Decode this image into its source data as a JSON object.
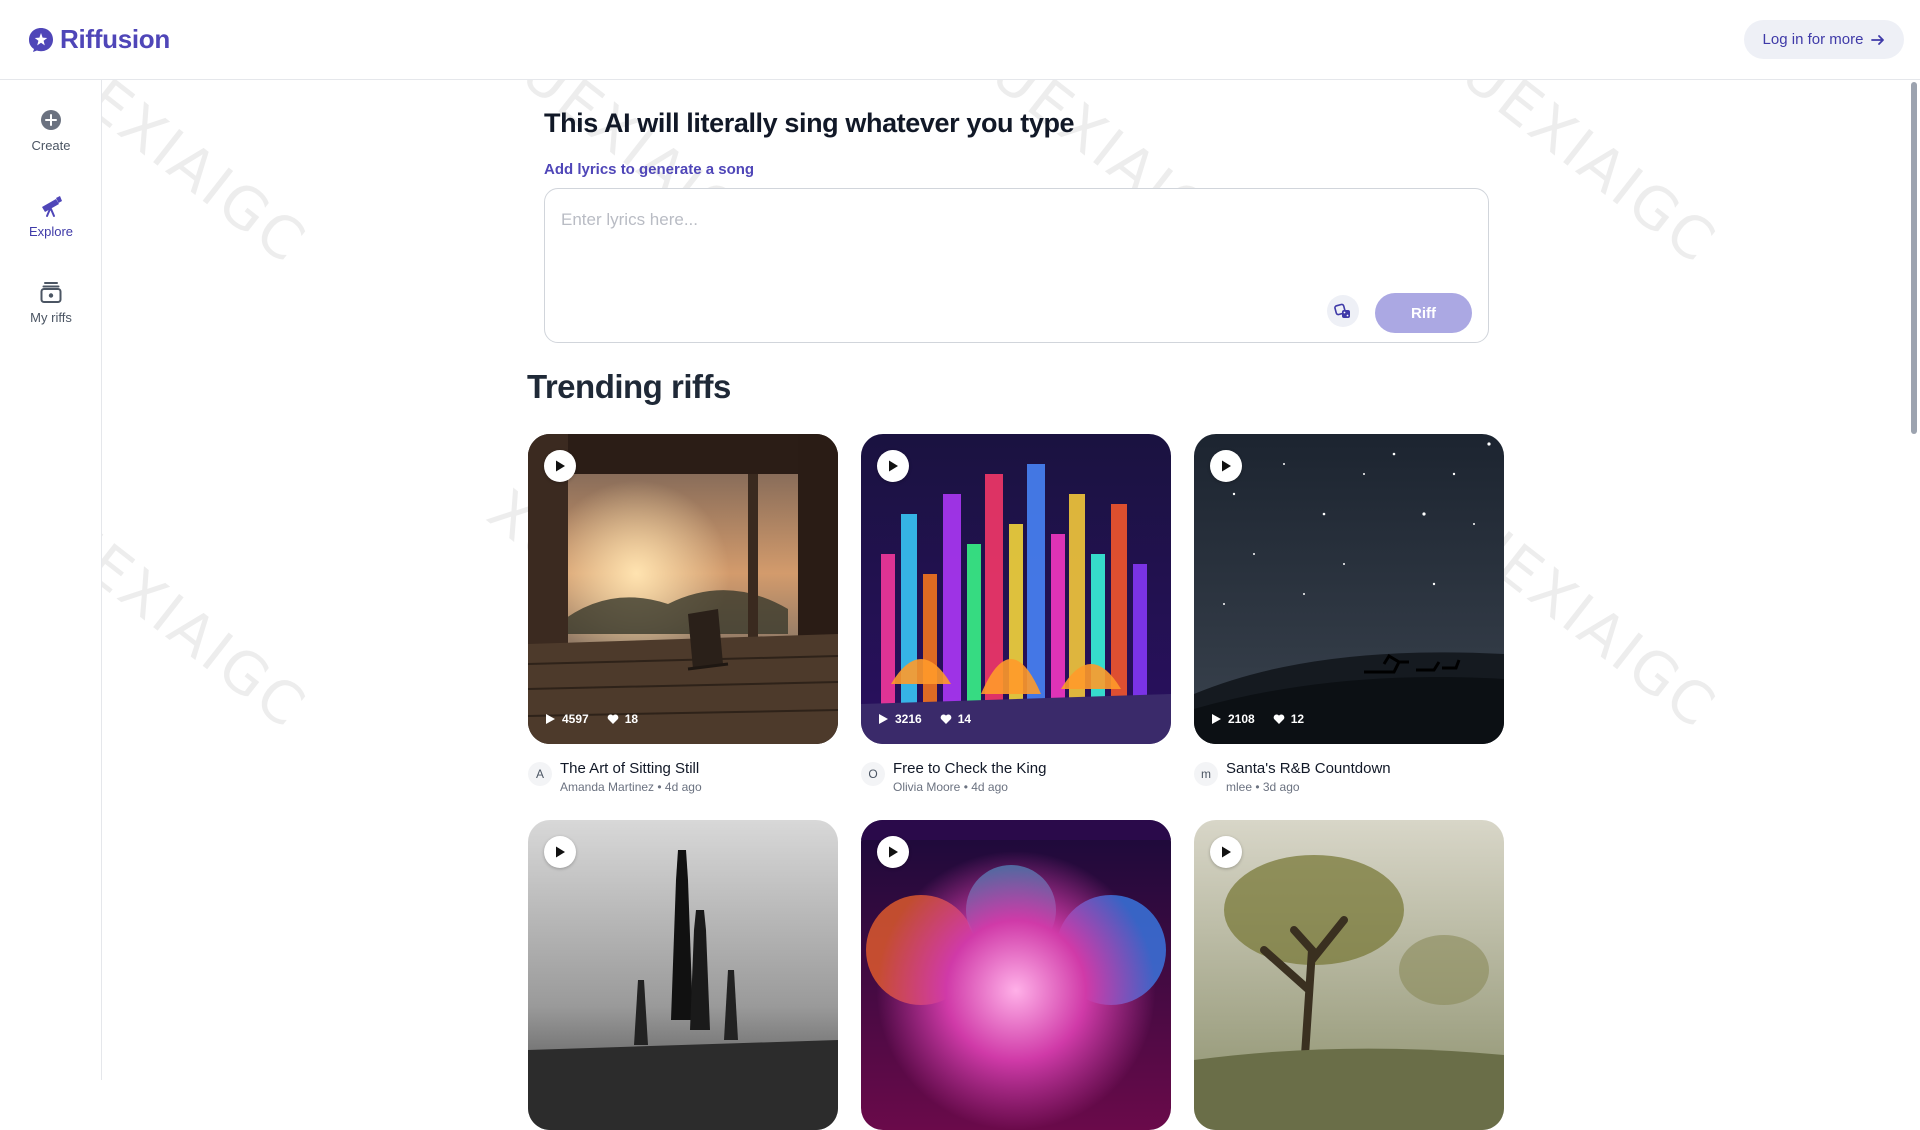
{
  "header": {
    "logo_text": "Riffusion",
    "login_label": "Log in for more"
  },
  "sidebar": {
    "items": [
      {
        "label": "Create",
        "icon": "plus-circle-icon",
        "active": false
      },
      {
        "label": "Explore",
        "icon": "telescope-icon",
        "active": true
      },
      {
        "label": "My riffs",
        "icon": "stack-icon",
        "active": false
      }
    ]
  },
  "hero": {
    "title": "This AI will literally sing whatever you type",
    "lyrics_label": "Add lyrics to generate a song",
    "lyrics_placeholder": "Enter lyrics here...",
    "lyrics_value": "",
    "riff_label": "Riff"
  },
  "trending": {
    "title": "Trending riffs",
    "cards": [
      {
        "title": "The Art of Sitting Still",
        "author": "Amanda Martinez",
        "age": "4d ago",
        "avatar": "A",
        "plays": "4597",
        "likes": "18",
        "sub": "Amanda Martinez • 4d ago"
      },
      {
        "title": "Free to Check the King",
        "author": "Olivia Moore",
        "age": "4d ago",
        "avatar": "O",
        "plays": "3216",
        "likes": "14",
        "sub": "Olivia Moore • 4d ago"
      },
      {
        "title": "Santa's R&B Countdown",
        "author": "mlee",
        "age": "3d ago",
        "avatar": "m",
        "plays": "2108",
        "likes": "12",
        "sub": "mlee • 3d ago"
      },
      {
        "title": "",
        "plays": "",
        "likes": ""
      },
      {
        "title": "",
        "plays": "",
        "likes": ""
      },
      {
        "title": "",
        "plays": "",
        "likes": ""
      }
    ]
  },
  "watermark": {
    "text": "XUEXIAIGC"
  },
  "colors": {
    "brand": "#4f46b8",
    "riff_button": "#aba8e3",
    "login_bg": "#eef0f6"
  }
}
